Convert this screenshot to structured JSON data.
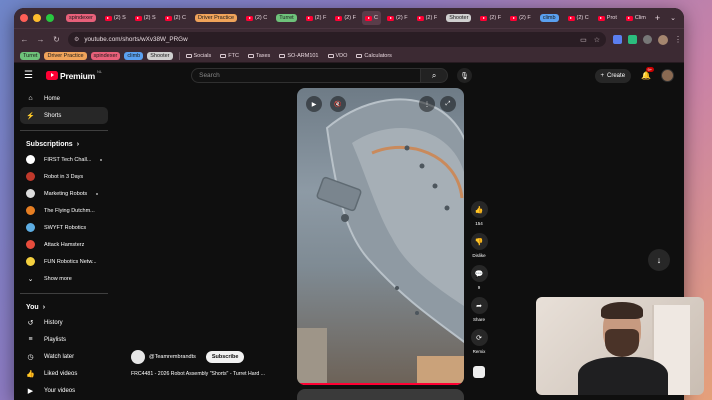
{
  "browser": {
    "tabs": [
      {
        "label": "spindexer",
        "group": true,
        "group_color": "#e8607a"
      },
      {
        "label": "(2) S",
        "group": false
      },
      {
        "label": "(2) S",
        "group": false
      },
      {
        "label": "(2) C",
        "group": false
      },
      {
        "label": "Driver Practice",
        "group": true,
        "group_color": "#f0a35a"
      },
      {
        "label": "(2) C",
        "group": false
      },
      {
        "label": "Turret",
        "group": true,
        "group_color": "#6ec27a"
      },
      {
        "label": "(2) F",
        "group": false
      },
      {
        "label": "(2) F",
        "group": false
      },
      {
        "label": "C",
        "group": false,
        "active": true
      },
      {
        "label": "(2) F",
        "group": false
      },
      {
        "label": "(2) F",
        "group": false
      },
      {
        "label": "Shooter",
        "group": true,
        "group_color": "#cfcfcf"
      },
      {
        "label": "(2) F",
        "group": false
      },
      {
        "label": "(2) F",
        "group": false
      },
      {
        "label": "climb",
        "group": true,
        "group_color": "#5aa0f0"
      },
      {
        "label": "(2) C",
        "group": false
      },
      {
        "label": "Prot",
        "group": false
      },
      {
        "label": "Clim",
        "group": false
      }
    ],
    "new_tab": "+",
    "url": "youtube.com/shorts/wXv38W_PRGw",
    "bookmarks_groups": [
      {
        "label": "Turret",
        "color": "#6ec27a"
      },
      {
        "label": "Driver Practice",
        "color": "#f0a35a"
      },
      {
        "label": "spindexer",
        "color": "#e8607a"
      },
      {
        "label": "climb",
        "color": "#5aa0f0"
      },
      {
        "label": "Shooter",
        "color": "#cfcfcf"
      }
    ],
    "bookmark_folders": [
      "Socials",
      "FTC",
      "Taxes",
      "SO-ARM101",
      "VDO",
      "Calculators"
    ]
  },
  "youtube": {
    "logo_text": "Premium",
    "logo_country": "NL",
    "search_placeholder": "Search",
    "create_label": "Create",
    "notifications_count": "9+",
    "nav": [
      {
        "label": "Home",
        "icon": "home-icon",
        "selected": false
      },
      {
        "label": "Shorts",
        "icon": "shorts-icon",
        "selected": true
      }
    ],
    "subscriptions_title": "Subscriptions",
    "subscriptions": [
      {
        "name": "FIRST Tech Chall...",
        "dot": true,
        "color": "#ffffff"
      },
      {
        "name": "Robot in 3 Days",
        "dot": false,
        "color": "#c0392b"
      },
      {
        "name": "Marketing Robots",
        "dot": true,
        "color": "#dddddd"
      },
      {
        "name": "The Flying Dutchm...",
        "dot": false,
        "color": "#e67e22"
      },
      {
        "name": "SWYFT Robotics",
        "dot": false,
        "color": "#5dade2"
      },
      {
        "name": "Attack Hamsterz",
        "dot": false,
        "color": "#e74c3c"
      },
      {
        "name": "FUN Robotics Netw...",
        "dot": false,
        "color": "#f4d03f"
      }
    ],
    "show_more": "Show more",
    "you_title": "You",
    "you_items": [
      {
        "label": "History",
        "icon": "history-icon"
      },
      {
        "label": "Playlists",
        "icon": "playlists-icon"
      },
      {
        "label": "Watch later",
        "icon": "watch-later-icon"
      },
      {
        "label": "Liked videos",
        "icon": "liked-videos-icon"
      },
      {
        "label": "Your videos",
        "icon": "your-videos-icon"
      }
    ],
    "short": {
      "channel": "@Teamrembrandts",
      "subscribe_label": "Subscribe",
      "title": "FRC4481 - 2026 Robot Assembly \"Shorts\" - Turret Hard ...",
      "progress": 1.0
    },
    "actions": {
      "likes": "154",
      "dislike_label": "Dislike",
      "comments": "9",
      "share_label": "Share",
      "remix_label": "Remix"
    }
  }
}
